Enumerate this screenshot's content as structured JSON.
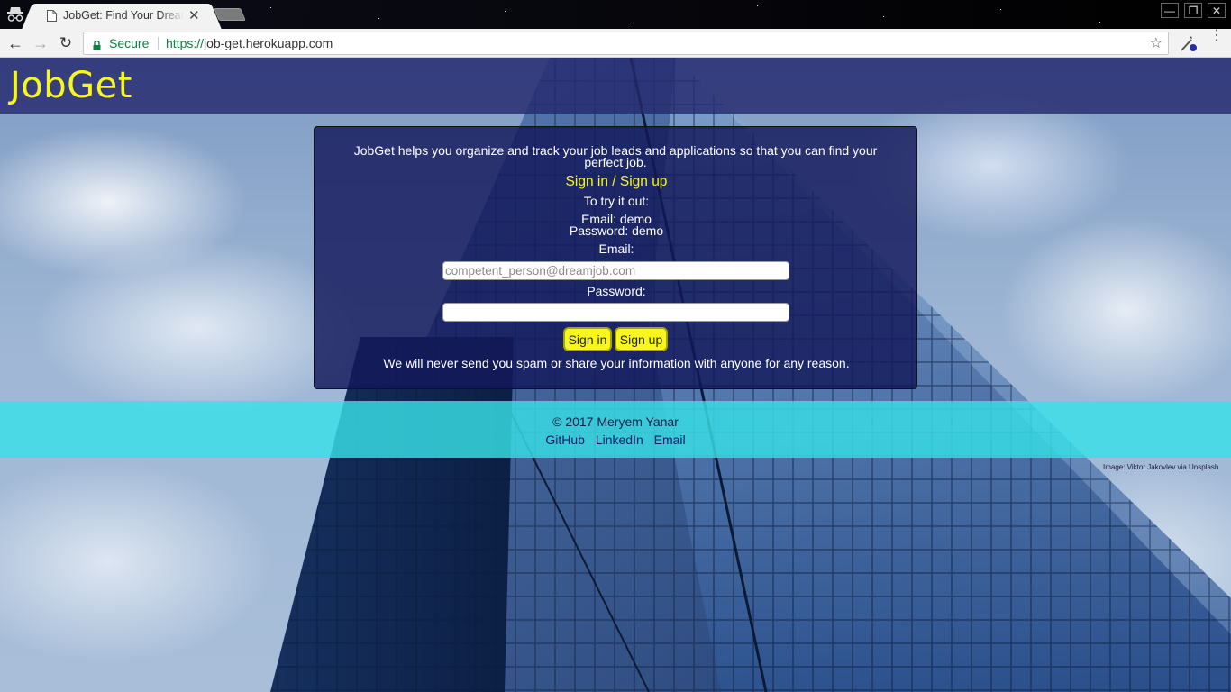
{
  "browser": {
    "tab_title": "JobGet: Find Your Dream Job",
    "secure_label": "Secure",
    "url_scheme": "https://",
    "url_host": "job-get.herokuapp.com",
    "bookmark_glyph": "☆",
    "back_glyph": "←",
    "forward_glyph": "→",
    "reload_glyph": "↻",
    "close_glyph": "✕",
    "min_glyph": "—",
    "max_glyph": "❐",
    "winclose_glyph": "✕",
    "menu_glyph": "⋮"
  },
  "site": {
    "logo": "JobGet",
    "colors": {
      "header": "#24286e",
      "accent": "#f7f71d",
      "footer": "#38e1e8"
    }
  },
  "card": {
    "intro": "JobGet helps you organize and track your job leads and applications so that you can find your perfect job.",
    "heading": "Sign in / Sign up",
    "tryout": "To try it out:",
    "demo_email": "Email: demo",
    "demo_password": "Password: demo",
    "email_label": "Email:",
    "email_placeholder": "competent_person@dreamjob.com",
    "email_value": "",
    "password_label": "Password:",
    "password_value": "",
    "signin_button": "Sign in",
    "signup_button": "Sign up",
    "privacy": "We will never send you spam or share your information with anyone for any reason."
  },
  "footer": {
    "copyright": "© 2017 Meryem Yanar",
    "links": [
      "GitHub",
      "LinkedIn",
      "Email"
    ]
  },
  "image_credit": "Image: Viktor Jakovlev via Unsplash"
}
